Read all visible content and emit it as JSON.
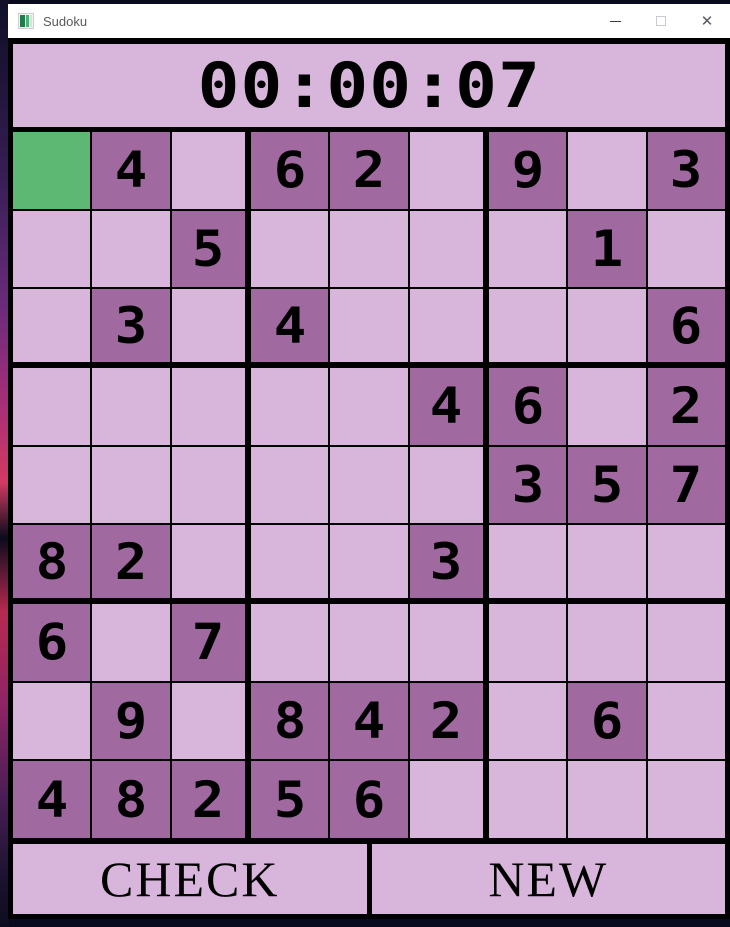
{
  "window": {
    "title": "Sudoku",
    "icon": "sudoku-app-icon",
    "controls": {
      "minimize": "–",
      "maximize": "□",
      "close": "✕"
    }
  },
  "timer": {
    "label": "elapsed-time",
    "value": "00:00:07"
  },
  "colors": {
    "empty_cell": "#d8b6dc",
    "filled_cell": "#a06aa0",
    "selected_cell": "#5cb873",
    "grid_line": "#000000",
    "digit": "#000000",
    "panel": "#d8b6dc"
  },
  "board": {
    "size": 9,
    "selected": {
      "row": 0,
      "col": 0
    },
    "rows": [
      [
        "",
        "4",
        "",
        "6",
        "2",
        "",
        "9",
        "",
        "3"
      ],
      [
        "",
        "",
        "5",
        "",
        "",
        "",
        "",
        "1",
        ""
      ],
      [
        "",
        "3",
        "",
        "4",
        "",
        "",
        "",
        "",
        "6"
      ],
      [
        "",
        "",
        "",
        "",
        "",
        "4",
        "6",
        "",
        "2"
      ],
      [
        "",
        "",
        "",
        "",
        "",
        "",
        "3",
        "5",
        "7"
      ],
      [
        "8",
        "2",
        "",
        "",
        "",
        "3",
        "",
        "",
        ""
      ],
      [
        "6",
        "",
        "7",
        "",
        "",
        "",
        "",
        "",
        ""
      ],
      [
        "",
        "9",
        "",
        "8",
        "4",
        "2",
        "",
        "6",
        ""
      ],
      [
        "4",
        "8",
        "2",
        "5",
        "6",
        "",
        "",
        "",
        ""
      ]
    ]
  },
  "buttons": {
    "check_label": "CHECK",
    "new_label": "NEW"
  }
}
